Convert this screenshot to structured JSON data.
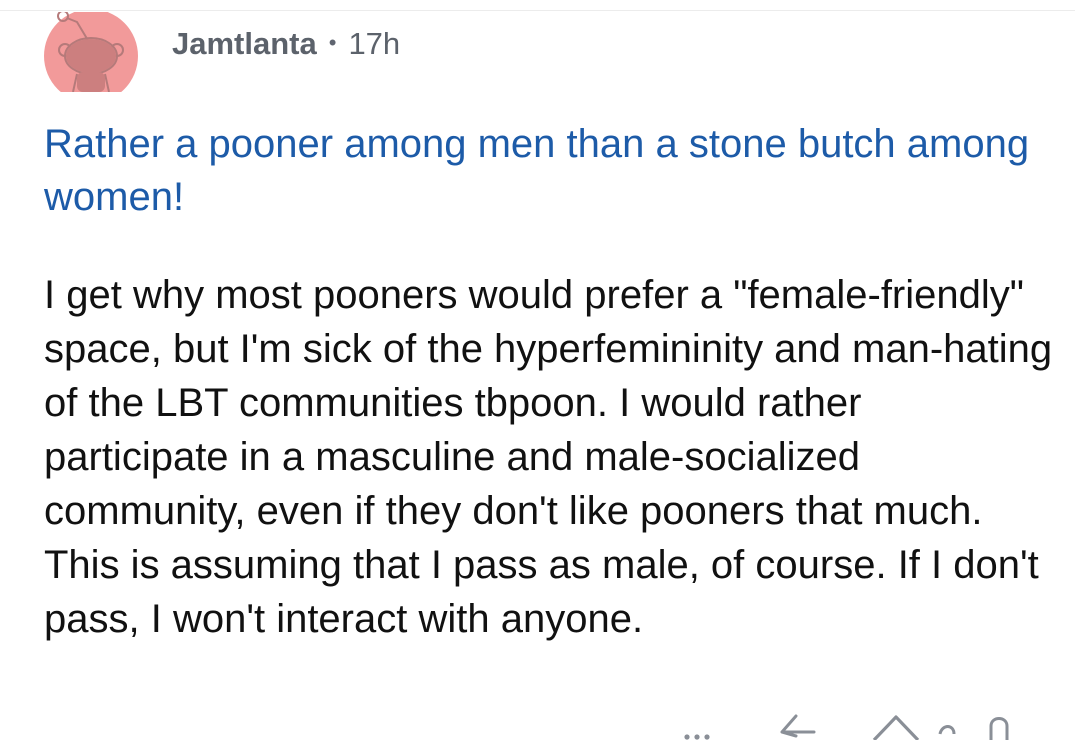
{
  "comment": {
    "author": "Jamtlanta",
    "separator": "•",
    "age": "17h",
    "title": "Rather a pooner among men than a stone butch among women!",
    "body": "I get why most pooners would prefer a \"female-friendly\" space, but I'm sick of the hyperfemininity and man-hating of the LBT communities tbpoon. I would rather participate in a masculine and male-socialized community, even if they don't like pooners that much. This is assuming that I pass as male, of course. If I don't pass, I won't interact with anyone.",
    "avatar_icon": "snoo-avatar-icon",
    "colors": {
      "title": "#1d5ba8",
      "avatar_bg": "#f29a9a",
      "meta": "#5c626b"
    }
  },
  "actions": {
    "more_icon": "more-dots-icon",
    "reply_icon": "reply-arrow-icon",
    "upvote_icon": "upvote-arrow-icon",
    "downvote_icon": "downvote-arrow-icon"
  }
}
